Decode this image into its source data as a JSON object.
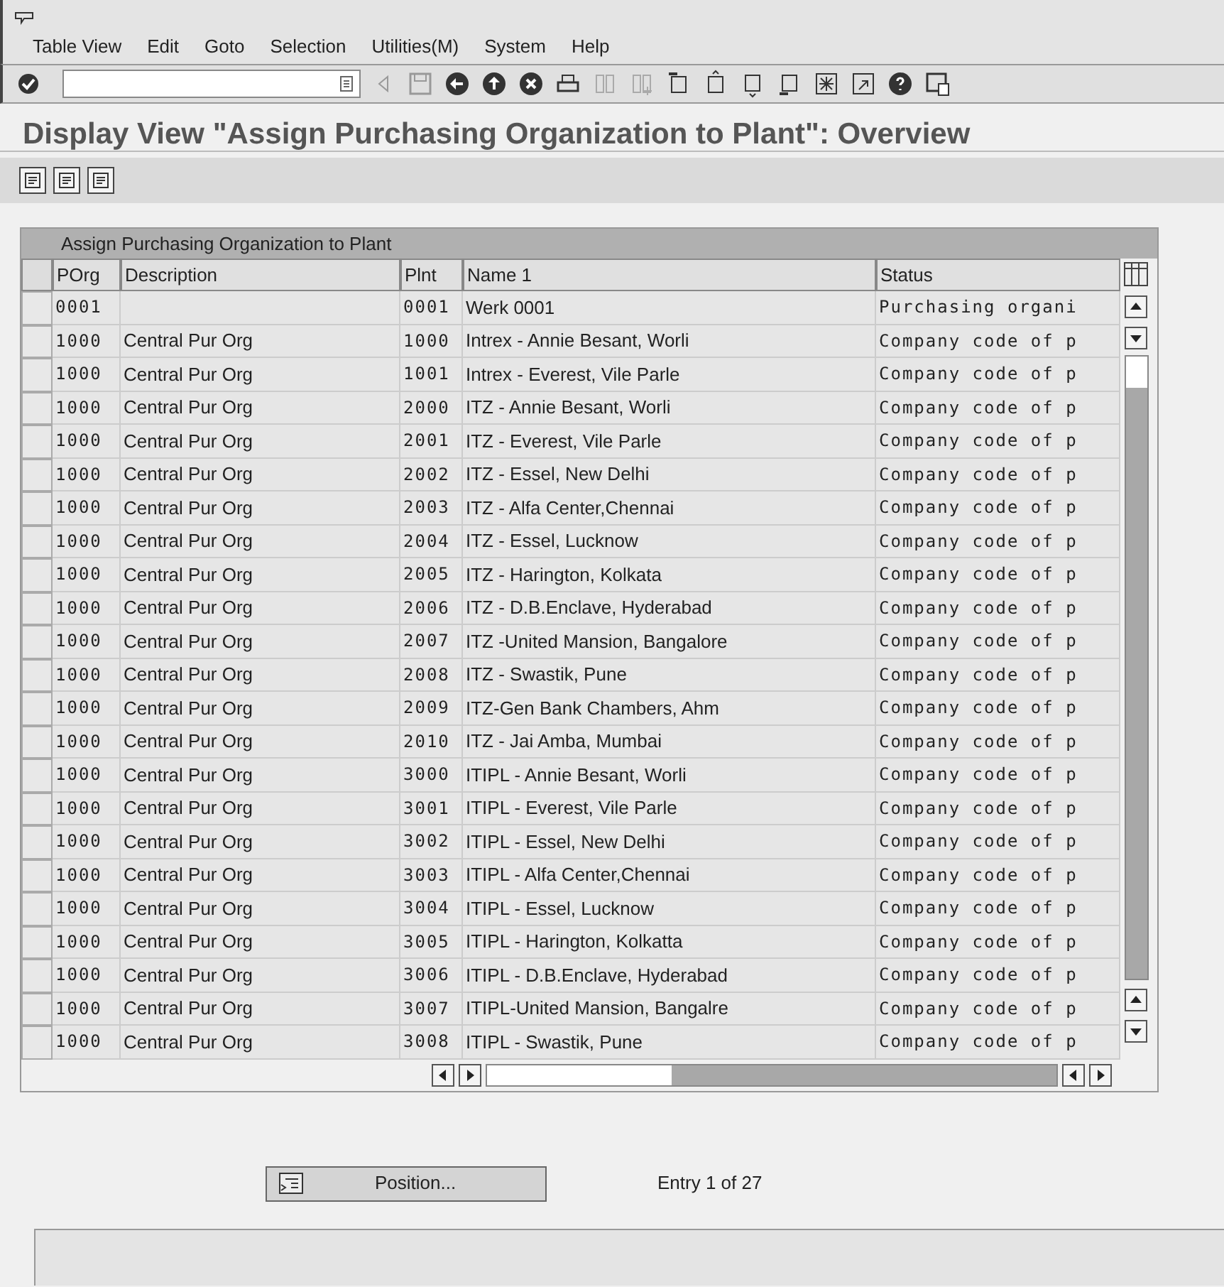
{
  "menu": [
    "Table View",
    "Edit",
    "Goto",
    "Selection",
    "Utilities(M)",
    "System",
    "Help"
  ],
  "title": "Display View \"Assign Purchasing Organization to Plant\": Overview",
  "table": {
    "title": "Assign Purchasing Organization to Plant",
    "columns": [
      "POrg",
      "Description",
      "Plnt",
      "Name 1",
      "Status"
    ],
    "rows": [
      [
        "0001",
        "",
        "0001",
        "Werk 0001",
        "Purchasing organi"
      ],
      [
        "1000",
        "Central Pur Org",
        "1000",
        "Intrex - Annie Besant, Worli",
        "Company code of p"
      ],
      [
        "1000",
        "Central Pur Org",
        "1001",
        "Intrex - Everest, Vile Parle",
        "Company code of p"
      ],
      [
        "1000",
        "Central Pur Org",
        "2000",
        "ITZ - Annie Besant, Worli",
        "Company code of p"
      ],
      [
        "1000",
        "Central Pur Org",
        "2001",
        "ITZ - Everest, Vile Parle",
        "Company code of p"
      ],
      [
        "1000",
        "Central Pur Org",
        "2002",
        "ITZ - Essel, New Delhi",
        "Company code of p"
      ],
      [
        "1000",
        "Central Pur Org",
        "2003",
        "ITZ - Alfa Center,Chennai",
        "Company code of p"
      ],
      [
        "1000",
        "Central Pur Org",
        "2004",
        "ITZ - Essel, Lucknow",
        "Company code of p"
      ],
      [
        "1000",
        "Central Pur Org",
        "2005",
        "ITZ - Harington, Kolkata",
        "Company code of p"
      ],
      [
        "1000",
        "Central Pur Org",
        "2006",
        "ITZ  - D.B.Enclave, Hyderabad",
        "Company code of p"
      ],
      [
        "1000",
        "Central Pur Org",
        "2007",
        "ITZ -United Mansion, Bangalore",
        "Company code of p"
      ],
      [
        "1000",
        "Central Pur Org",
        "2008",
        "ITZ - Swastik, Pune",
        "Company code of p"
      ],
      [
        "1000",
        "Central Pur Org",
        "2009",
        "ITZ-Gen Bank Chambers, Ahm",
        "Company code of p"
      ],
      [
        "1000",
        "Central Pur Org",
        "2010",
        "ITZ - Jai Amba, Mumbai",
        "Company code of p"
      ],
      [
        "1000",
        "Central Pur Org",
        "3000",
        "ITIPL - Annie Besant, Worli",
        "Company code of p"
      ],
      [
        "1000",
        "Central Pur Org",
        "3001",
        "ITIPL - Everest, Vile Parle",
        "Company code of p"
      ],
      [
        "1000",
        "Central Pur Org",
        "3002",
        "ITIPL - Essel, New Delhi",
        "Company code of p"
      ],
      [
        "1000",
        "Central Pur Org",
        "3003",
        "ITIPL - Alfa Center,Chennai",
        "Company code of p"
      ],
      [
        "1000",
        "Central Pur Org",
        "3004",
        "ITIPL - Essel, Lucknow",
        "Company code of p"
      ],
      [
        "1000",
        "Central Pur Org",
        "3005",
        "ITIPL - Harington, Kolkatta",
        "Company code of p"
      ],
      [
        "1000",
        "Central Pur Org",
        "3006",
        "ITIPL - D.B.Enclave, Hyderabad",
        "Company code of p"
      ],
      [
        "1000",
        "Central Pur Org",
        "3007",
        "ITIPL-United Mansion, Bangalre",
        "Company code of p"
      ],
      [
        "1000",
        "Central Pur Org",
        "3008",
        "ITIPL - Swastik, Pune",
        "Company code of p"
      ]
    ]
  },
  "position_button": "Position...",
  "entry_info": "Entry 1 of 27"
}
